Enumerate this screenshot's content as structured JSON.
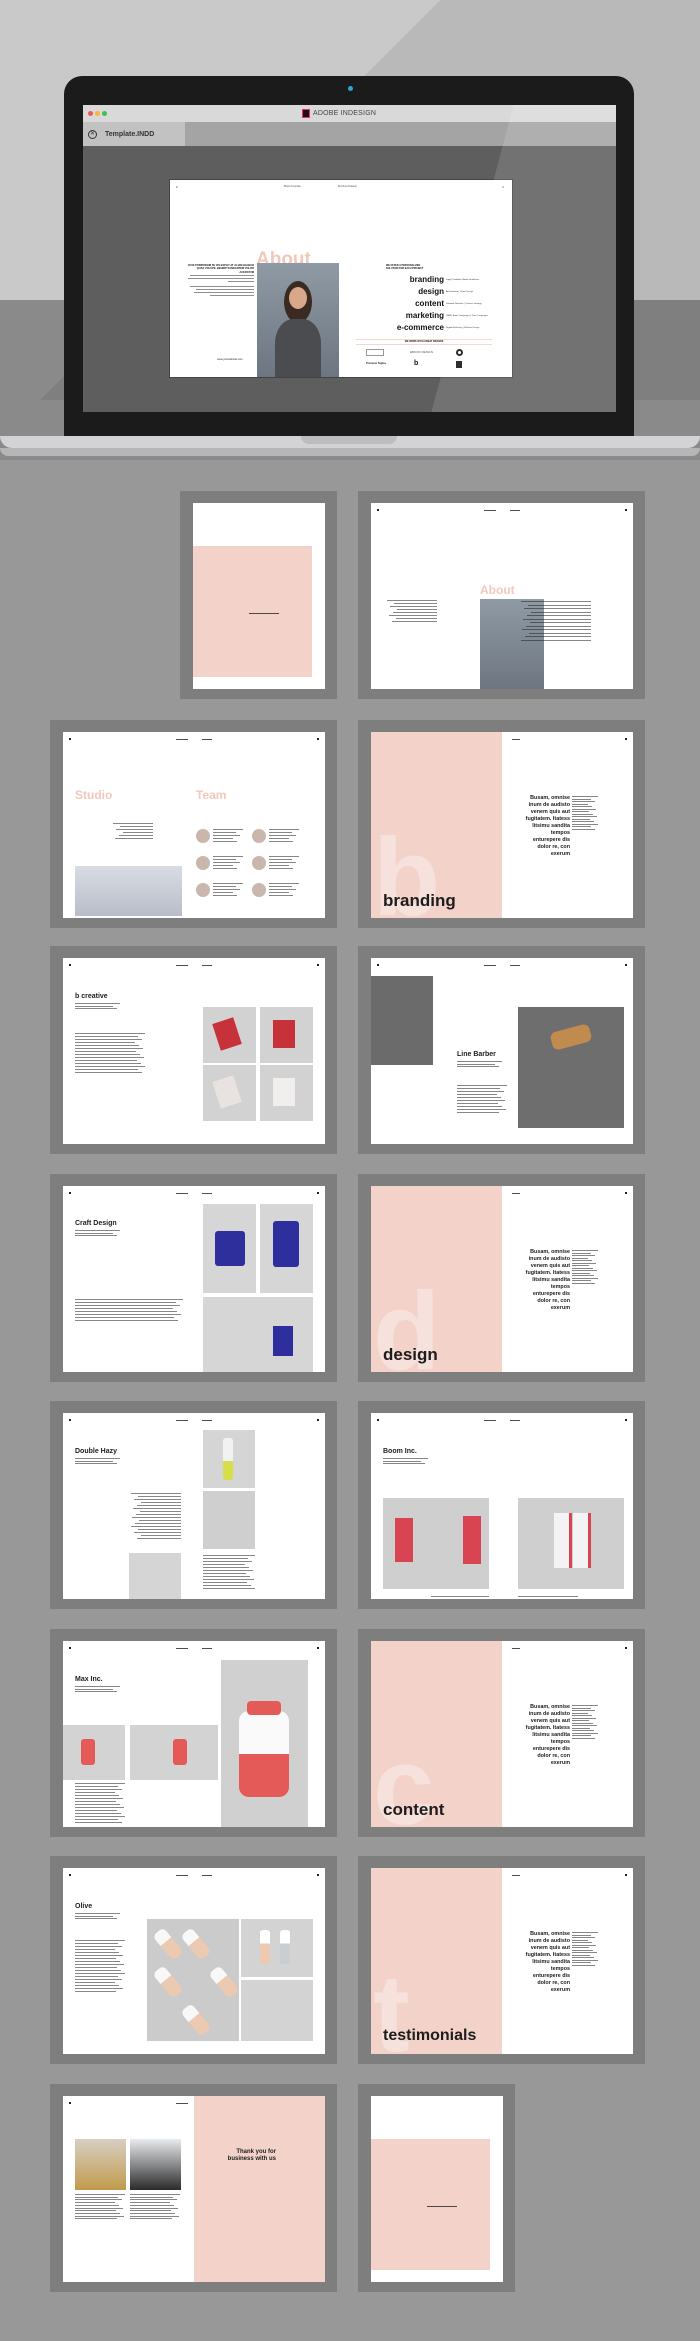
{
  "app": {
    "window_title": "ADOBE INDESIGN",
    "document_tab": "Template.INDD",
    "tab_close_icon": "close-circle-icon",
    "traffic_lights": [
      "close",
      "minimize",
      "zoom"
    ]
  },
  "colors": {
    "accent_pink": "#f2d2c9",
    "accent_pink_text": "#f2c8bb",
    "canvas_grey": "#5e5e5e",
    "tile_frame": "#7f7e7f",
    "background": "#989898"
  },
  "main_spread": {
    "page_left_number": "2",
    "page_right_number": "3",
    "running_header_left": "Brand Template",
    "running_header_right": "Brochure/Catalog",
    "title": "About",
    "intro_heading": "DUIS PORROSSIM TE VIS EXPLIT AT ALIAM HILIBI ID QUAS VOLUPE. BEHRIP SANDANTEM VOLOR ACERATUM",
    "website": "www.yourwebsite.com",
    "offer_heading": "WE OFFER A PERSONALIZED SOLUTION FOR EACH PROJECT",
    "services": [
      {
        "name": "branding",
        "detail": "Logo | Portfolio | Brand Guidelines"
      },
      {
        "name": "design",
        "detail": "Art Direction | Visual Design"
      },
      {
        "name": "content",
        "detail": "Creative Direction | Content Strategy"
      },
      {
        "name": "marketing",
        "detail": "CRM | Email Campaigns | Print Campaigns"
      },
      {
        "name": "e-commerce",
        "detail": "Digital Marketing | Website Design"
      }
    ],
    "brands_heading": "WE WORK WITH GREAT BRANDS",
    "brands": [
      "brand-logo-1",
      "EBOOK DESIGN",
      "Q studio",
      "Provious Tuples",
      "b creative",
      "studio mark"
    ]
  },
  "thumbnails": [
    {
      "id": "cover",
      "kind": "single",
      "label": ""
    },
    {
      "id": "about",
      "kind": "spread",
      "title": "About"
    },
    {
      "id": "studio-team",
      "kind": "spread",
      "titles": [
        "Studio",
        "Team"
      ]
    },
    {
      "id": "branding",
      "kind": "section",
      "letter": "b",
      "word": "branding"
    },
    {
      "id": "b-creative",
      "kind": "spread",
      "title": "b creative"
    },
    {
      "id": "line-barber",
      "kind": "spread",
      "title": "Line Barber"
    },
    {
      "id": "craft-design",
      "kind": "spread",
      "title": "Craft Design"
    },
    {
      "id": "design",
      "kind": "section",
      "letter": "d",
      "word": "design"
    },
    {
      "id": "double-hazy",
      "kind": "spread",
      "title": "Double Hazy"
    },
    {
      "id": "boom-inc",
      "kind": "spread",
      "title": "Boom Inc."
    },
    {
      "id": "max-inc",
      "kind": "spread",
      "title": "Max Inc."
    },
    {
      "id": "content",
      "kind": "section",
      "letter": "c",
      "word": "content"
    },
    {
      "id": "olive",
      "kind": "spread",
      "title": "Olive"
    },
    {
      "id": "testimonials",
      "kind": "section",
      "letter": "t",
      "word": "testimonials"
    },
    {
      "id": "thank-you",
      "kind": "spread",
      "title": "Thank you for business with us"
    },
    {
      "id": "back-cover",
      "kind": "single",
      "label": ""
    }
  ],
  "section_text": "Busam, omnise inum de audisto venem quis aut fugitatem. Itatess litsimu sandita tempos enturepere dis dolor re, con exerum",
  "thank_you_lines": [
    "Thank you",
    "for business",
    "with us"
  ]
}
